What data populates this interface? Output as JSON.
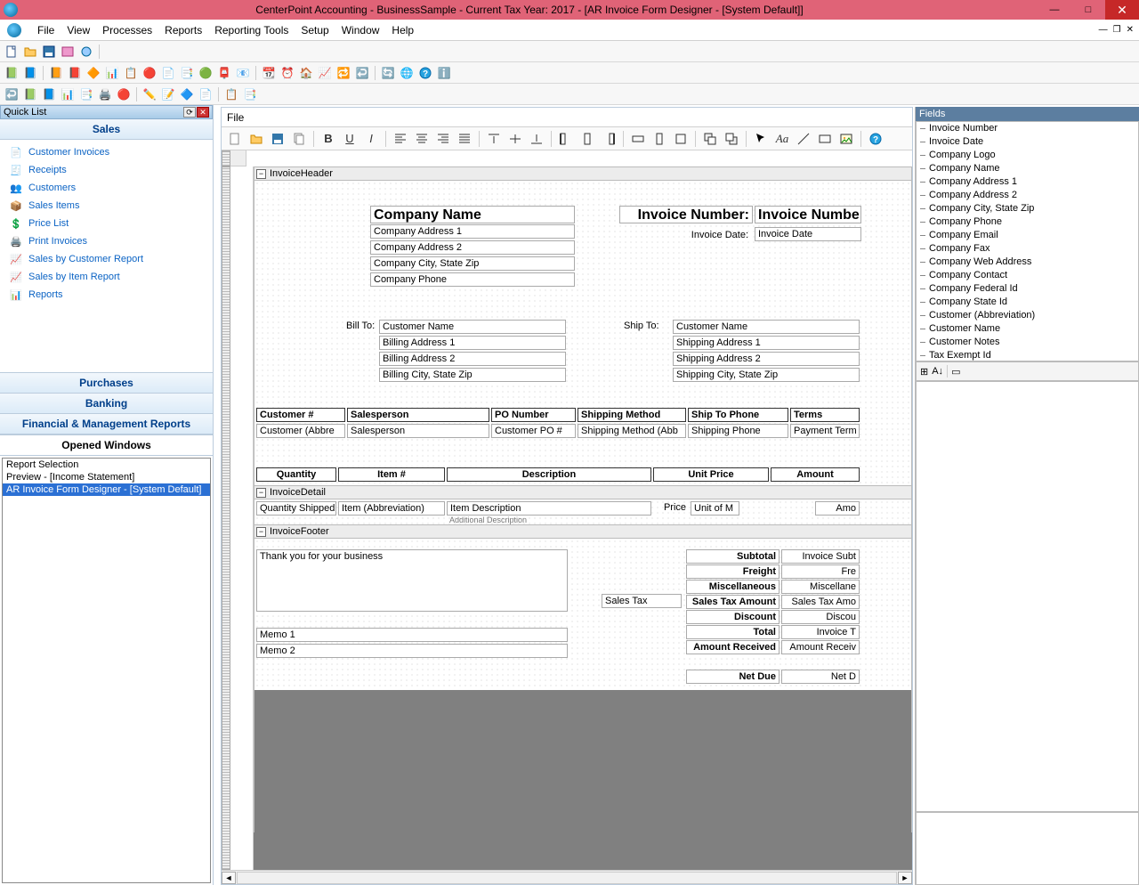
{
  "titlebar": {
    "title": "CenterPoint Accounting - BusinessSample - Current Tax Year: 2017 - [AR Invoice Form Designer - [System Default]]"
  },
  "menu": {
    "items": [
      "File",
      "View",
      "Processes",
      "Reports",
      "Reporting Tools",
      "Setup",
      "Window",
      "Help"
    ]
  },
  "quicklist": {
    "title": "Quick List",
    "section": "Sales",
    "items": [
      {
        "icon": "invoice",
        "label": "Customer Invoices"
      },
      {
        "icon": "receipt",
        "label": "Receipts"
      },
      {
        "icon": "customers",
        "label": "Customers"
      },
      {
        "icon": "sales-items",
        "label": "Sales Items"
      },
      {
        "icon": "price-list",
        "label": "Price List"
      },
      {
        "icon": "print",
        "label": "Print Invoices"
      },
      {
        "icon": "report",
        "label": "Sales by Customer Report"
      },
      {
        "icon": "report",
        "label": "Sales by Item Report"
      },
      {
        "icon": "reports",
        "label": "Reports"
      }
    ],
    "collapsed": [
      "Purchases",
      "Banking",
      "Financial & Management Reports"
    ],
    "opened_header": "Opened Windows",
    "opened": [
      {
        "label": "Report Selection",
        "selected": false
      },
      {
        "label": "Preview - [Income Statement]",
        "selected": false
      },
      {
        "label": "AR Invoice Form Designer - [System Default]",
        "selected": true
      }
    ]
  },
  "designer": {
    "file_menu": "File",
    "sections": {
      "invoice_header": "InvoiceHeader",
      "invoice_detail": "InvoiceDetail",
      "invoice_footer": "InvoiceFooter"
    },
    "header": {
      "company_name": "Company Name",
      "addr1": "Company Address 1",
      "addr2": "Company Address 2",
      "csz": "Company City, State Zip",
      "phone": "Company Phone",
      "invoice_number_lbl": "Invoice Number:",
      "invoice_number_val": "Invoice Numbe",
      "invoice_date_lbl": "Invoice Date:",
      "invoice_date_val": "Invoice Date",
      "bill_to": "Bill To:",
      "bill_name": "Customer Name",
      "bill_addr1": "Billing Address 1",
      "bill_addr2": "Billing Address 2",
      "bill_csz": "Billing City, State Zip",
      "ship_to": "Ship To:",
      "ship_name": "Customer Name",
      "ship_addr1": "Shipping Address 1",
      "ship_addr2": "Shipping Address 2",
      "ship_csz": "Shipping City, State Zip",
      "row_hdrs": [
        "Customer #",
        "Salesperson",
        "PO Number",
        "Shipping Method",
        "Ship To Phone",
        "Terms"
      ],
      "row_vals": [
        "Customer (Abbre",
        "Salesperson",
        "Customer PO #",
        "Shipping Method (Abb",
        "Shipping Phone",
        "Payment Term"
      ],
      "col_hdrs": [
        "Quantity",
        "Item #",
        "Description",
        "Unit Price",
        "Amount"
      ]
    },
    "detail": {
      "qty": "Quantity Shipped",
      "item": "Item (Abbreviation)",
      "desc": "Item Description",
      "desc2": "Additional Description",
      "price_lbl": "Price",
      "unit": "Unit of M",
      "amount": "Amo"
    },
    "footer": {
      "thanks": "Thank you for your business",
      "sales_tax": "Sales Tax",
      "memo1": "Memo 1",
      "memo2": "Memo 2",
      "labels": [
        "Subtotal",
        "Freight",
        "Miscellaneous",
        "Sales Tax Amount",
        "Discount",
        "Total",
        "Amount Received",
        "Net Due"
      ],
      "values": [
        "Invoice Subt",
        "Fre",
        "Miscellane",
        "Sales Tax Amo",
        "Discou",
        "Invoice T",
        "Amount Receiv",
        "Net D"
      ]
    }
  },
  "fields_panel": {
    "title": "Fields",
    "items": [
      "Invoice Number",
      "Invoice Date",
      "Company Logo",
      "Company Name",
      "Company Address 1",
      "Company Address 2",
      "Company City, State Zip",
      "Company Phone",
      "Company Email",
      "Company Fax",
      "Company Web Address",
      "Company Contact",
      "Company Federal Id",
      "Company State Id",
      "Customer (Abbreviation)",
      "Customer Name",
      "Customer Notes",
      "Tax Exempt Id"
    ]
  }
}
